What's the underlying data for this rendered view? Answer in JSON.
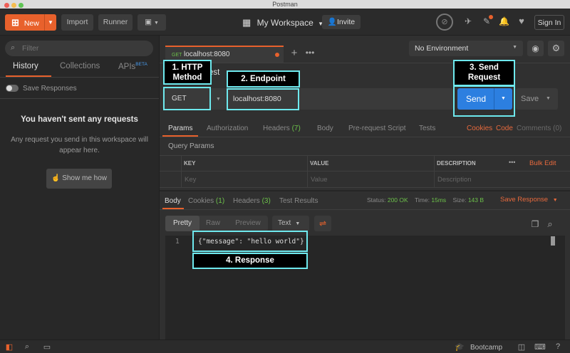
{
  "window": {
    "title": "Postman"
  },
  "header": {
    "new_label": "New",
    "import_label": "Import",
    "runner_label": "Runner",
    "workspace_label": "My Workspace",
    "invite_label": "Invite",
    "signin_label": "Sign In",
    "colors": {
      "accent": "#e8612c",
      "annotation": "#6ee9ee",
      "send": "#2c7fe0"
    }
  },
  "sidebar": {
    "filter_placeholder": "Filter",
    "tabs": [
      {
        "label": "History"
      },
      {
        "label": "Collections"
      },
      {
        "label": "APIs"
      }
    ],
    "apis_badge": "BETA",
    "save_responses_label": "Save Responses",
    "empty_title": "You haven't sent any requests",
    "empty_text": "Any request you send in this workspace will appear here.",
    "show_me_label": "Show me how"
  },
  "request_tab": {
    "method": "GET",
    "url": "localhost:8080"
  },
  "environment": {
    "selected": "No Environment"
  },
  "request": {
    "title_fragment": "est",
    "method": "GET",
    "url": "localhost:8080",
    "send_label": "Send",
    "save_label": "Save"
  },
  "req_tabs": [
    {
      "label": "Params"
    },
    {
      "label": "Authorization"
    },
    {
      "label": "Headers",
      "count": "(7)"
    },
    {
      "label": "Body"
    },
    {
      "label": "Pre-request Script"
    },
    {
      "label": "Tests"
    }
  ],
  "req_right": {
    "cookies": "Cookies",
    "code": "Code",
    "comments": "Comments (0)"
  },
  "params": {
    "title": "Query Params",
    "headers": [
      "KEY",
      "VALUE",
      "DESCRIPTION"
    ],
    "placeholders": [
      "Key",
      "Value",
      "Description"
    ],
    "bulk_edit": "Bulk Edit"
  },
  "response": {
    "tabs": [
      {
        "label": "Body"
      },
      {
        "label": "Cookies",
        "count": "(1)"
      },
      {
        "label": "Headers",
        "count": "(3)"
      },
      {
        "label": "Test Results"
      }
    ],
    "status_label": "Status:",
    "status_value": "200 OK",
    "time_label": "Time:",
    "time_value": "15ms",
    "size_label": "Size:",
    "size_value": "143 B",
    "save_response": "Save Response",
    "views": [
      "Pretty",
      "Raw",
      "Preview"
    ],
    "format": "Text",
    "line_number": "1",
    "body": "{\"message\": \"hello world\"}"
  },
  "annotations": [
    {
      "text": "1. HTTP Method"
    },
    {
      "text": "2. Endpoint"
    },
    {
      "text": "3. Send Request"
    },
    {
      "text": "4. Response"
    }
  ],
  "footer": {
    "bootcamp_label": "Bootcamp"
  }
}
